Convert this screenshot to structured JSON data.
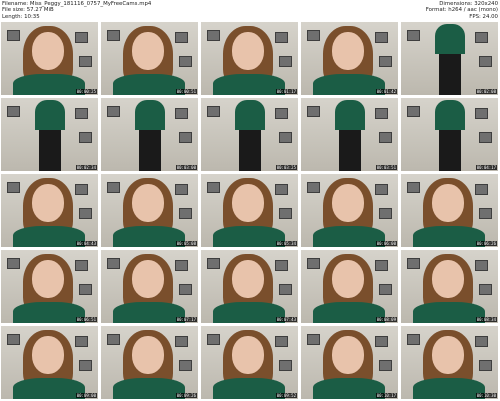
{
  "header": {
    "filename": "Filename: Miss_Peggy_181116_0757_MyFreeCams.mp4",
    "filesize": "File size: 57.27 MiB",
    "length": "Length: 10:35",
    "dimensions": "Dimensions: 320x240",
    "format": "Format: h264 / aac (mono)",
    "fps": "FPS: 24.00"
  },
  "thumbnails": [
    {
      "ts": "00:00:25",
      "scene": "face"
    },
    {
      "ts": "00:00:51",
      "scene": "face"
    },
    {
      "ts": "00:01:17",
      "scene": "face"
    },
    {
      "ts": "00:01:42",
      "scene": "face"
    },
    {
      "ts": "00:02:08",
      "scene": "body"
    },
    {
      "ts": "00:02:34",
      "scene": "body"
    },
    {
      "ts": "00:03:00",
      "scene": "body"
    },
    {
      "ts": "00:03:25",
      "scene": "body"
    },
    {
      "ts": "00:03:51",
      "scene": "body"
    },
    {
      "ts": "00:04:17",
      "scene": "body"
    },
    {
      "ts": "00:04:43",
      "scene": "face"
    },
    {
      "ts": "00:05:08",
      "scene": "face"
    },
    {
      "ts": "00:05:34",
      "scene": "face"
    },
    {
      "ts": "00:06:00",
      "scene": "face"
    },
    {
      "ts": "00:06:26",
      "scene": "face"
    },
    {
      "ts": "00:06:51",
      "scene": "face"
    },
    {
      "ts": "00:07:17",
      "scene": "face"
    },
    {
      "ts": "00:07:43",
      "scene": "face"
    },
    {
      "ts": "00:08:09",
      "scene": "face"
    },
    {
      "ts": "00:08:34",
      "scene": "face"
    },
    {
      "ts": "00:09:00",
      "scene": "face"
    },
    {
      "ts": "00:09:26",
      "scene": "face"
    },
    {
      "ts": "00:09:52",
      "scene": "face"
    },
    {
      "ts": "00:10:17",
      "scene": "face"
    },
    {
      "ts": "00:10:30",
      "scene": "face"
    }
  ]
}
